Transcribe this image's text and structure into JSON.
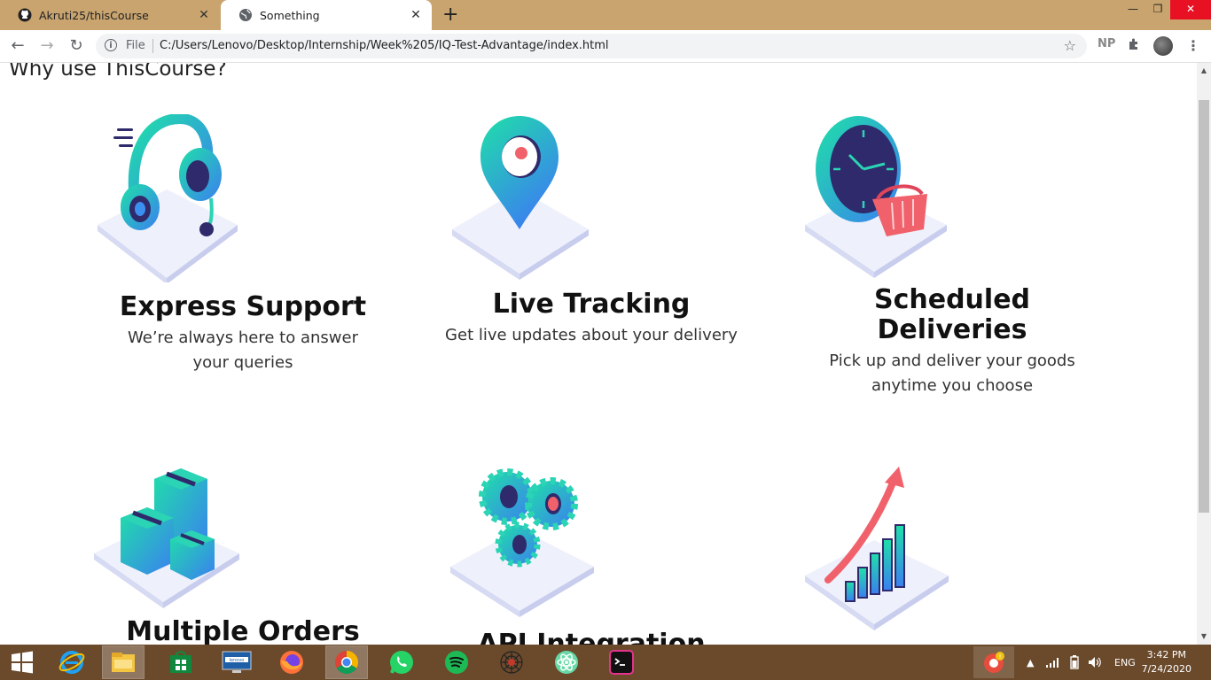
{
  "browser": {
    "tabs": [
      {
        "title": "Akruti25/thisCourse",
        "icon": "github-icon"
      },
      {
        "title": "Something",
        "icon": "globe-icon",
        "active": true
      }
    ],
    "new_tab_symbol": "+",
    "close_symbol": "✕",
    "address": {
      "scheme_label": "File",
      "url": "C:/Users/Lenovo/Desktop/Internship/Week%205/IQ-Test-Advantage/index.html"
    },
    "extension_badge": "NP"
  },
  "page": {
    "heading": "Why use ThisCourse?",
    "features": [
      {
        "title": "Express Support",
        "description": "We’re always here to answer your queries",
        "icon": "headset-icon"
      },
      {
        "title": "Live Tracking",
        "description": "Get live updates about your delivery",
        "icon": "location-pin-icon"
      },
      {
        "title": "Scheduled Deliveries",
        "description": "Pick up and deliver your goods anytime you choose",
        "icon": "clock-basket-icon"
      },
      {
        "title": "Multiple Orders",
        "description": "",
        "icon": "boxes-icon"
      },
      {
        "title": "API Integration",
        "description": "",
        "icon": "gears-icon"
      },
      {
        "title": "",
        "description": "",
        "icon": "growth-chart-icon"
      }
    ]
  },
  "taskbar": {
    "language": "ENG",
    "time": "3:42 PM",
    "date": "7/24/2020",
    "apps": [
      "windows-start-icon",
      "internet-explorer-icon",
      "file-explorer-icon",
      "store-icon",
      "lenovo-icon",
      "firefox-icon",
      "chrome-icon",
      "whatsapp-icon",
      "spotify-icon",
      "spider-icon",
      "atom-icon",
      "terminal-icon"
    ]
  },
  "colors": {
    "tabbar": "#c9a46e",
    "taskbar": "#6b4a2c",
    "accent_teal": "#2ad4b4",
    "accent_blue": "#3b8ff0",
    "accent_red": "#f0616b"
  }
}
